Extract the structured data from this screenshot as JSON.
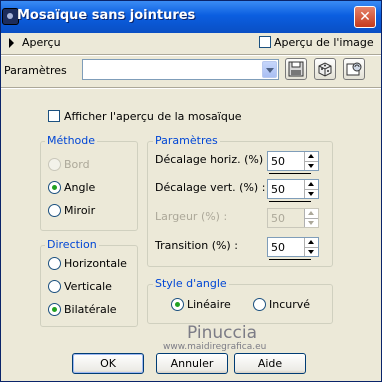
{
  "window": {
    "title": "Mosaïque sans jointures"
  },
  "preview_bar": {
    "label": "Aperçu",
    "checkbox_label": "Aperçu de l'image"
  },
  "params_row": {
    "label": "Paramètres",
    "value": ""
  },
  "mosaic_preview": {
    "label": "Afficher l'aperçu de la mosaïque"
  },
  "methode": {
    "legend": "Méthode",
    "options": [
      "Bord",
      "Angle",
      "Miroir"
    ],
    "selected": "Angle",
    "disabled": [
      "Bord"
    ]
  },
  "direction": {
    "legend": "Direction",
    "options": [
      "Horizontale",
      "Verticale",
      "Bilatérale"
    ],
    "selected": "Bilatérale"
  },
  "parametres": {
    "legend": "Paramètres",
    "fields": [
      {
        "label": "Décalage horiz. (%) :",
        "value": "50",
        "enabled": true
      },
      {
        "label": "Décalage vert. (%) :",
        "value": "50",
        "enabled": true
      },
      {
        "label": "Largeur (%) :",
        "value": "50",
        "enabled": false
      },
      {
        "label": "Transition (%) :",
        "value": "50",
        "enabled": true
      }
    ]
  },
  "style_angle": {
    "legend": "Style d'angle",
    "options": [
      "Linéaire",
      "Incurvé"
    ],
    "selected": "Linéaire"
  },
  "buttons": {
    "ok": "OK",
    "cancel": "Annuler",
    "help": "Aide"
  },
  "watermark": {
    "name": "Pinuccia",
    "url": "www.maidiregrafica.eu"
  },
  "colors": {
    "titlebar": "#0b5ee0",
    "dialog_bg": "#ece9d8",
    "legend_text": "#0046d5",
    "radio_dot": "#21a121",
    "close_button": "#c53a1c"
  },
  "icons": [
    "app-icon",
    "close-icon",
    "expand-arrow-icon",
    "dropdown-arrow-icon",
    "save-preset-icon",
    "reset-preset-icon",
    "manage-presets-icon"
  ]
}
